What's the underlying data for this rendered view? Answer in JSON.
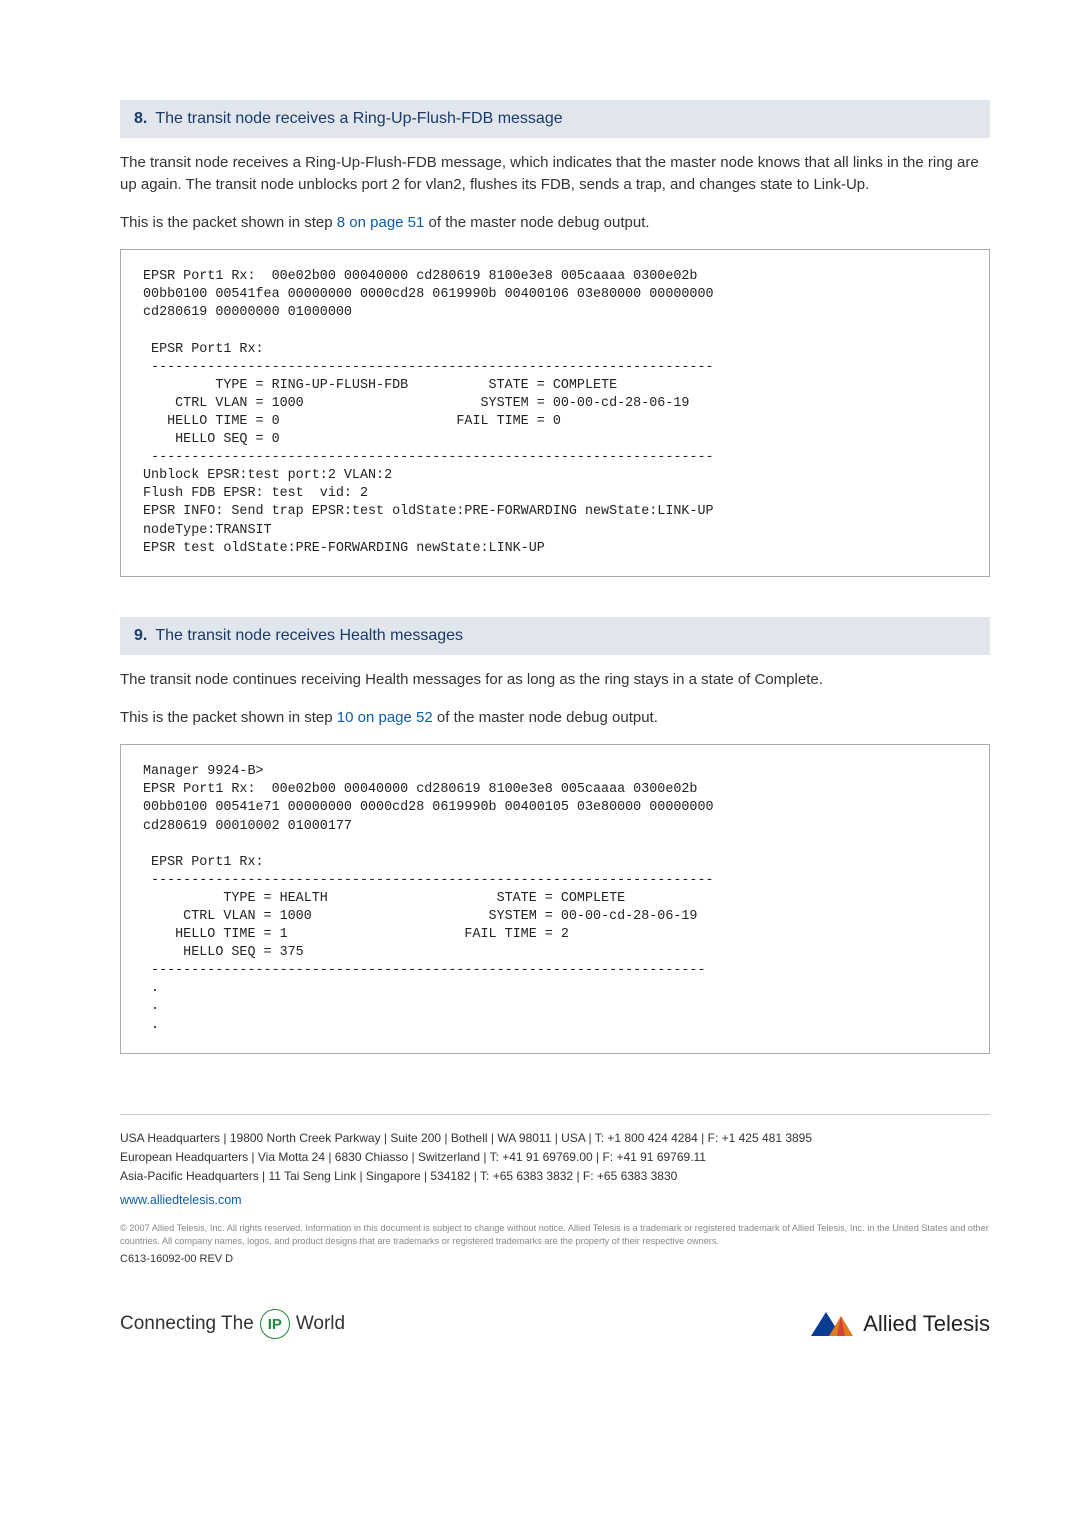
{
  "step8": {
    "num": "8.",
    "title": "The transit node receives a Ring-Up-Flush-FDB message",
    "para1": "The transit node receives a Ring-Up-Flush-FDB message, which indicates that the master node knows that all links in the ring are up again. The transit node unblocks port 2 for vlan2, flushes its FDB, sends a trap, and changes state to Link-Up.",
    "para2_a": "This is the packet shown in step ",
    "para2_link": "8 on page 51",
    "para2_b": " of the master node debug output.",
    "code": "EPSR Port1 Rx:  00e02b00 00040000 cd280619 8100e3e8 005caaaa 0300e02b\n00bb0100 00541fea 00000000 0000cd28 0619990b 00400106 03e80000 00000000\ncd280619 00000000 01000000\n\n EPSR Port1 Rx:\n ----------------------------------------------------------------------\n         TYPE = RING-UP-FLUSH-FDB          STATE = COMPLETE\n    CTRL VLAN = 1000                      SYSTEM = 00-00-cd-28-06-19\n   HELLO TIME = 0                      FAIL TIME = 0\n    HELLO SEQ = 0\n ----------------------------------------------------------------------\nUnblock EPSR:test port:2 VLAN:2\nFlush FDB EPSR: test  vid: 2\nEPSR INFO: Send trap EPSR:test oldState:PRE-FORWARDING newState:LINK-UP\nnodeType:TRANSIT\nEPSR test oldState:PRE-FORWARDING newState:LINK-UP"
  },
  "step9": {
    "num": "9.",
    "title": "The transit node receives Health messages",
    "para1": "The transit node continues receiving Health messages for as long as the ring stays in a state of Complete.",
    "para2_a": "This is the packet shown in step ",
    "para2_link": "10 on page 52",
    "para2_b": " of the master node debug output.",
    "code": "Manager 9924-B>\nEPSR Port1 Rx:  00e02b00 00040000 cd280619 8100e3e8 005caaaa 0300e02b\n00bb0100 00541e71 00000000 0000cd28 0619990b 00400105 03e80000 00000000\ncd280619 00010002 01000177\n\n EPSR Port1 Rx:\n ----------------------------------------------------------------------\n          TYPE = HEALTH                     STATE = COMPLETE\n     CTRL VLAN = 1000                      SYSTEM = 00-00-cd-28-06-19\n    HELLO TIME = 1                      FAIL TIME = 2\n     HELLO SEQ = 375\n ---------------------------------------------------------------------\n .\n .\n ."
  },
  "footer": {
    "usa": "USA Headquarters | 19800 North Creek Parkway | Suite 200 | Bothell | WA 98011 | USA | T: +1 800 424 4284 | F: +1 425 481 3895",
    "eur": "European Headquarters | Via Motta 24 | 6830 Chiasso | Switzerland | T: +41 91 69769.00 | F: +41 91 69769.11",
    "asia": "Asia-Pacific Headquarters | 11 Tai Seng Link | Singapore | 534182 | T: +65 6383 3832 | F: +65 6383 3830",
    "url": "www.alliedtelesis.com",
    "disclaimer": "© 2007 Allied Telesis, Inc. All rights reserved. Information in this document is subject to change without notice. Allied Telesis is a trademark or registered trademark of Allied Telesis, Inc. in the United States and other countries. All company names, logos, and product designs that are trademarks or registered trademarks are the property of their respective owners.",
    "rev": "C613-16092-00 REV D",
    "connecting_a": "Connecting The",
    "connecting_ip": "IP",
    "connecting_b": "World",
    "brand": "Allied Telesis"
  }
}
